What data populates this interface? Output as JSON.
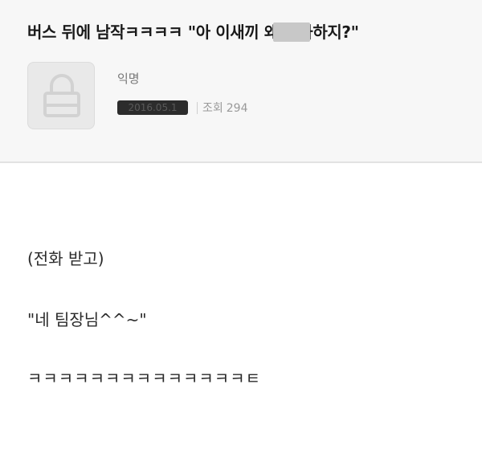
{
  "post": {
    "title": "버스 뒤에 남작ㅋㅋㅋㅋ \"아 이새끼 왜 전화하지?\"",
    "author": "익명",
    "date": "2016.05.1",
    "views_label": "조회",
    "views_count": "294"
  },
  "content": {
    "lines": [
      "(전화 받고)",
      "\"네 팀장님^^~\"",
      "ㅋㅋㅋㅋㅋㅋㅋㅋㅋㅋㅋㅋㅋㅋㅌ"
    ]
  },
  "icons": {
    "avatar": "lock-icon"
  }
}
